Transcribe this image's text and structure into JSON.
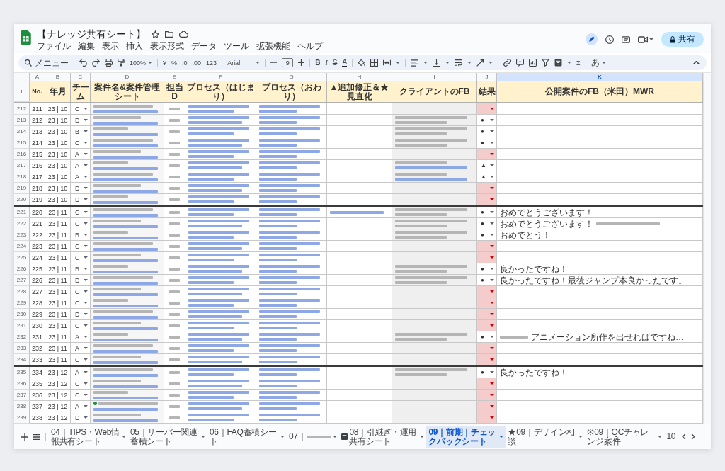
{
  "window": {
    "title": "【ナレッジ共有シート】"
  },
  "menu": [
    "ファイル",
    "編集",
    "表示",
    "挿入",
    "表示形式",
    "データ",
    "ツール",
    "拡張機能",
    "ヘルプ"
  ],
  "toolbar": {
    "menu_search": {
      "placeholder": "メニュー"
    },
    "zoom": "100%",
    "currency": "¥",
    "percent": "%",
    "decimal_decrease": ".0",
    "decimal_increase": ".00",
    "number_format": "123",
    "font": "Arial",
    "font_size": "9",
    "bold": "B",
    "italic": "I",
    "strikethrough": "S",
    "text_color": "A",
    "functions": "Σ",
    "input_tools": "あ"
  },
  "share_button": {
    "label": "共有"
  },
  "columns": [
    {
      "letter": "A",
      "selected": false
    },
    {
      "letter": "B",
      "selected": false
    },
    {
      "letter": "C",
      "selected": false
    },
    {
      "letter": "D",
      "selected": false
    },
    {
      "letter": "E",
      "selected": false
    },
    {
      "letter": "F",
      "selected": false
    },
    {
      "letter": "G",
      "selected": false
    },
    {
      "letter": "H",
      "selected": false
    },
    {
      "letter": "I",
      "selected": false
    },
    {
      "letter": "J",
      "selected": false
    },
    {
      "letter": "K",
      "selected": true
    }
  ],
  "header_row": {
    "row_number": "1",
    "cells": [
      "No.",
      "年月",
      "チーム",
      "案件名&案件管理シート",
      "担当D",
      "プロセス（はじまり）",
      "プロセス（おわり）",
      "▲追加修正＆★見直化",
      "クライアントのFB",
      "結果",
      "公開案件のFB（米田）MWR"
    ]
  },
  "row_groups": [
    {
      "rows": [
        {
          "row_number": "212",
          "no": "211",
          "month": "23 | 10",
          "team": "C"
        },
        {
          "row_number": "213",
          "no": "212",
          "month": "23 | 10",
          "team": "D",
          "feedback": {
            "kind": "text"
          },
          "result": "●"
        },
        {
          "row_number": "214",
          "no": "213",
          "month": "23 | 10",
          "team": "B",
          "feedback": {
            "kind": "text"
          },
          "result": "●"
        },
        {
          "row_number": "215",
          "no": "214",
          "month": "23 | 10",
          "team": "C",
          "feedback": {
            "kind": "text"
          },
          "result": "●"
        },
        {
          "row_number": "216",
          "no": "215",
          "month": "23 | 10",
          "team": "A"
        },
        {
          "row_number": "217",
          "no": "216",
          "month": "23 | 10",
          "team": "A",
          "feedback": {
            "kind": "link"
          },
          "result": "▲"
        },
        {
          "row_number": "218",
          "no": "217",
          "month": "23 | 10",
          "team": "A",
          "feedback": {
            "kind": "link"
          },
          "result": "▲"
        },
        {
          "row_number": "219",
          "no": "218",
          "month": "23 | 10",
          "team": "D"
        },
        {
          "row_number": "220",
          "no": "219",
          "month": "23 | 10",
          "team": "D"
        }
      ]
    },
    {
      "rows": [
        {
          "row_number": "221",
          "no": "220",
          "month": "23 | 11",
          "team": "C",
          "note": {
            "kind": "link"
          },
          "feedback": {
            "kind": "text"
          },
          "result": "●",
          "comment": [
            {
              "kind": "text",
              "text": "おめでとうございます！"
            }
          ]
        },
        {
          "row_number": "222",
          "no": "221",
          "month": "23 | 11",
          "team": "C",
          "feedback": {
            "kind": "text"
          },
          "result": "●",
          "comment": [
            {
              "kind": "text",
              "text": "おめでとうございます！"
            },
            {
              "kind": "blurred"
            }
          ]
        },
        {
          "row_number": "223",
          "no": "222",
          "month": "23 | 11",
          "team": "B",
          "feedback": {
            "kind": "text"
          },
          "result": "●",
          "comment": [
            {
              "kind": "text",
              "text": "おめでとう！"
            }
          ]
        },
        {
          "row_number": "224",
          "no": "223",
          "month": "23 | 11",
          "team": "C"
        },
        {
          "row_number": "225",
          "no": "224",
          "month": "23 | 11",
          "team": "C"
        },
        {
          "row_number": "226",
          "no": "225",
          "month": "23 | 11",
          "team": "B",
          "feedback": {
            "kind": "text"
          },
          "result": "●",
          "comment": [
            {
              "kind": "text",
              "text": "良かったですね！"
            }
          ]
        },
        {
          "row_number": "227",
          "no": "226",
          "month": "23 | 11",
          "team": "D",
          "feedback": {
            "kind": "text"
          },
          "result": "●",
          "comment": [
            {
              "kind": "text",
              "text": "良かったですね！最後ジャンプ本良かったです。"
            }
          ]
        },
        {
          "row_number": "228",
          "no": "227",
          "month": "23 | 11",
          "team": "C"
        },
        {
          "row_number": "229",
          "no": "228",
          "month": "23 | 11",
          "team": "C"
        },
        {
          "row_number": "230",
          "no": "229",
          "month": "23 | 11",
          "team": "D"
        },
        {
          "row_number": "231",
          "no": "230",
          "month": "23 | 11",
          "team": "C"
        },
        {
          "row_number": "232",
          "no": "231",
          "month": "23 | 11",
          "team": "A",
          "feedback": {
            "kind": "text"
          },
          "result": "●",
          "comment": [
            {
              "kind": "blurred"
            },
            {
              "kind": "text",
              "text": "アニメーション所作を出せればですね…"
            }
          ]
        },
        {
          "row_number": "233",
          "no": "232",
          "month": "23 | 11",
          "team": "A"
        },
        {
          "row_number": "234",
          "no": "233",
          "month": "23 | 11",
          "team": "C"
        }
      ]
    },
    {
      "rows": [
        {
          "row_number": "235",
          "no": "234",
          "month": "23 | 12",
          "team": "A",
          "feedback": {
            "kind": "text"
          },
          "result": "●",
          "comment": [
            {
              "kind": "text",
              "text": "良かったですね！"
            }
          ]
        },
        {
          "row_number": "236",
          "no": "235",
          "month": "23 | 12",
          "team": "C"
        },
        {
          "row_number": "237",
          "no": "236",
          "month": "23 | 12",
          "team": "C"
        },
        {
          "row_number": "238",
          "no": "237",
          "month": "23 | 12",
          "team": "A",
          "case": {
            "kind": "chip"
          }
        },
        {
          "row_number": "239",
          "no": "238",
          "month": "23 | 12",
          "team": "D"
        }
      ]
    }
  ],
  "sheet_tabs": [
    {
      "label": "04｜TIPS・Web情報共有シート",
      "selected": false,
      "kind": "sheet"
    },
    {
      "label": "05｜サーバー関連蓄積シート",
      "selected": false,
      "kind": "sheet"
    },
    {
      "label": "06｜FAQ蓄積シート",
      "selected": false,
      "kind": "sheet"
    },
    {
      "label": "07｜",
      "selected": false,
      "kind": "blurred"
    },
    {
      "label": "08｜引継ぎ・運用共有シート",
      "selected": false,
      "kind": "marked"
    },
    {
      "label": "09｜前期｜チェックバックシート",
      "selected": true,
      "kind": "sheet"
    },
    {
      "label": "★09｜デザイン相談",
      "selected": false,
      "kind": "sheet"
    },
    {
      "label": "※09｜QCチャレンジ案件",
      "selected": false,
      "kind": "sheet"
    },
    {
      "label": "10",
      "selected": false,
      "kind": "cut"
    }
  ]
}
